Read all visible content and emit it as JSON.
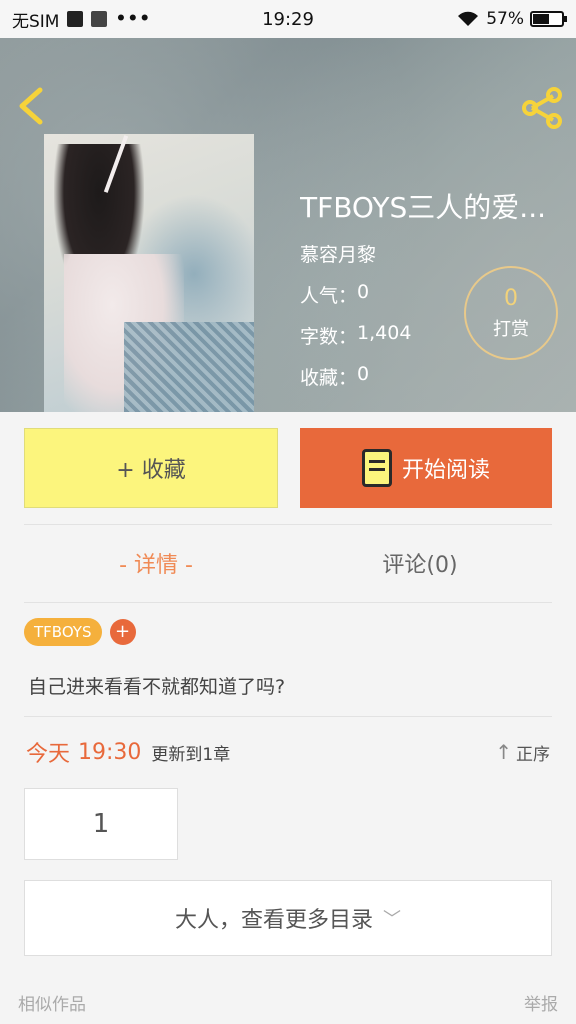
{
  "status_bar": {
    "carrier": "无SIM",
    "time": "19:29",
    "dots": "•••",
    "battery_percent": "57%"
  },
  "book": {
    "title": "TFBOYS三人的爱...",
    "author": "慕容月黎",
    "popularity_label": "人气：",
    "popularity": "0",
    "word_count_label": "字数：",
    "word_count": "1,404",
    "favorites_label": "收藏：",
    "favorites": "0"
  },
  "reward": {
    "count": "0",
    "label": "打赏"
  },
  "actions": {
    "favorite_label": "+ 收藏",
    "read_label": "开始阅读"
  },
  "tabs": [
    {
      "label": "- 详情 -"
    },
    {
      "label": "评论(0)"
    }
  ],
  "tags": [
    "TFBOYS"
  ],
  "tag_add": "+",
  "description": "自己进来看看不就都知道了吗?",
  "update": {
    "day": "今天",
    "time": "19:30",
    "text": "更新到1章",
    "sort_label": "正序"
  },
  "chapter": "1",
  "more_label": "大人，查看更多目录",
  "footer": {
    "similar": "相似作品",
    "report": "举报"
  },
  "colors": {
    "accent": "#e8693b",
    "favorite_button": "#fcf57d",
    "tag": "#f5b03c"
  }
}
